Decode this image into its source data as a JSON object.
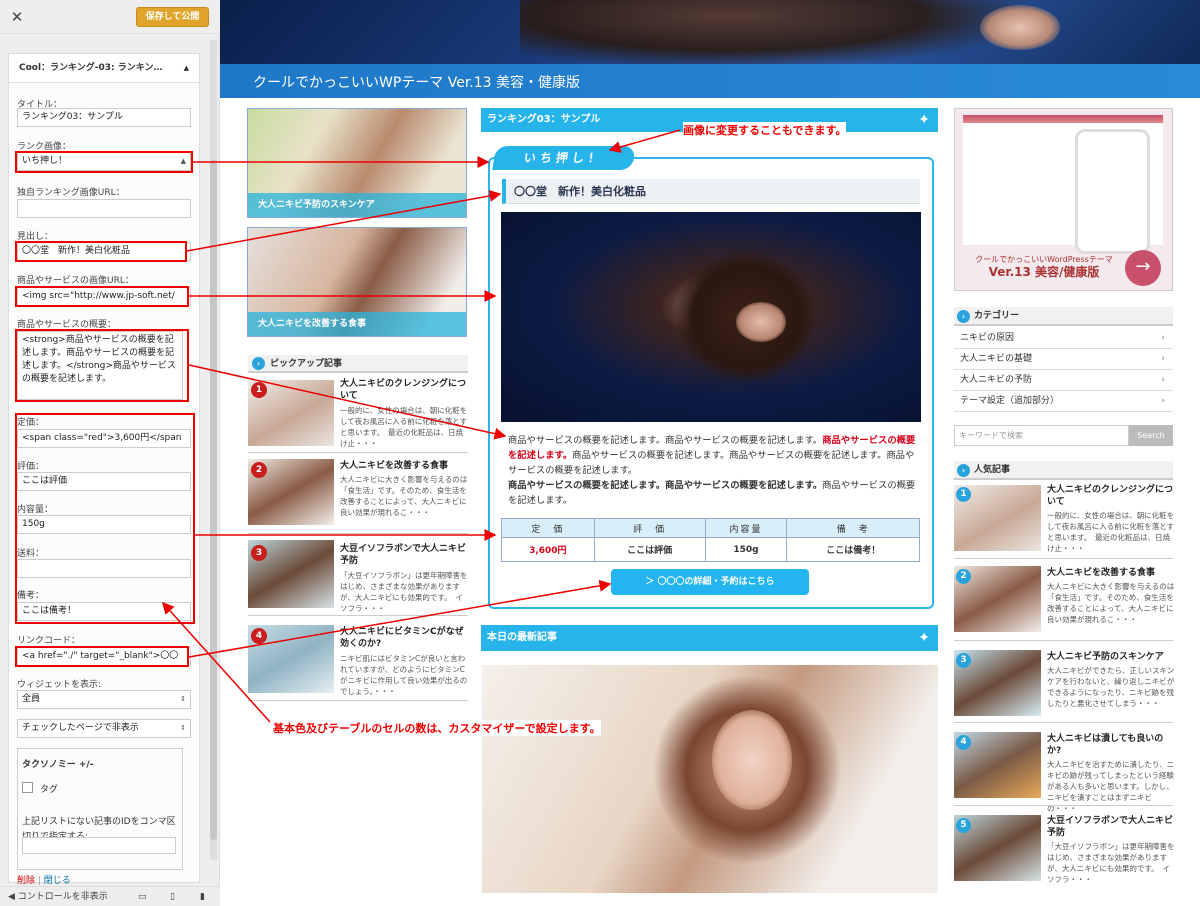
{
  "panel": {
    "close_label": "✕",
    "publish_label": "保存して公開",
    "widget_header": "Cool：ランキング-03: ランキン…",
    "fields": {
      "title_label": "タイトル：",
      "title_value": "ランキング03：サンプル",
      "rank_image_label": "ランク画像：",
      "rank_image_value": "いち押し！",
      "custom_rank_url_label": "独自ランキング画像URL：",
      "custom_rank_url_value": "",
      "heading_label": "見出し：",
      "heading_value": "〇〇堂　新作！美白化粧品",
      "image_url_label": "商品やサービスの画像URL：",
      "image_url_value": "<img src=\"http://www.jp-soft.net/",
      "summary_label": "商品やサービスの概要：",
      "summary_value": "<strong>商品やサービスの概要を記述します。商品やサービスの概要を記述します。</strong>商品やサービスの概要を記述します。",
      "price_label": "定価：",
      "price_value": "<span class=\"red\">3,600円</span",
      "rating_label": "評価：",
      "rating_value": "ここは評価",
      "volume_label": "内容量：",
      "volume_value": "150g",
      "shipping_label": "送料：",
      "shipping_value": "",
      "note_label": "備考：",
      "note_value": "ここは備考！",
      "link_label": "リンクコード：",
      "link_value": "<a href=\"./\" target=\"_blank\">〇〇",
      "show_widget_label": "ウィジェットを表示:",
      "show_widget_value": "全員",
      "hide_pages_value": "チェックしたページで非表示",
      "taxonomy_label": "タクソノミー +/-",
      "tag_label": "タグ",
      "id_note": "上記リストにない記事のIDをコンマ区切りで指定する:",
      "delete_label": "削除",
      "close_link_label": "閉じる",
      "footer_label": "コントロールを非表示"
    }
  },
  "site": {
    "title": "クールでかっこいいWPテーマ Ver.13 美容・健康版"
  },
  "left_column": {
    "feature1_caption": "大人ニキビ予防のスキンケア",
    "feature2_caption": "大人ニキビを改善する食事",
    "pickup_title": "ピックアップ記事",
    "pickup_items": [
      {
        "num": "1",
        "title": "大人ニキビのクレンジングについて",
        "excerpt": "一般的に、女性の場合は、朝に化粧をして夜お風呂に入る前に化粧を落とすと思います。　最近の化粧品は、日焼け止・・・"
      },
      {
        "num": "2",
        "title": "大人ニキビを改善する食事",
        "excerpt": "大人ニキビに大きく影響を与えるのは「食生活」です。そのため、食生活を改善することによって、大人ニキビに良い効果が現れるこ・・・"
      },
      {
        "num": "3",
        "title": "大豆イソフラボンで大人ニキビ予防",
        "excerpt": "「大豆イソフラボン」は更年期障害をはじめ、さまざまな効果がありますが、大人ニキビにも効果的です。　イソフラ・・・"
      },
      {
        "num": "4",
        "title": "大人ニキビにビタミンCがなぜ効くのか?",
        "excerpt": "ニキビ肌にはビタミンCが良いと言われていますが、どのようにビタミンCがニキビに作用して良い効果が出るのでしょう。・・・"
      }
    ]
  },
  "ranking": {
    "header": "ランキング03：サンプル",
    "badge": "いち押し！",
    "heading": "〇〇堂　新作！美白化粧品",
    "desc_1": "商品やサービスの概要を記述します。商品やサービスの概要を記述します。",
    "desc_red": "商品やサービスの概要を記述します。",
    "desc_2": "商品やサービスの概要を記述します。商品やサービスの概要を記述します。商品やサービスの概要を記述します。",
    "desc_bold": "商品やサービスの概要を記述します。商品やサービスの概要を記述します。",
    "desc_3": "商品やサービスの概要を記述します。",
    "table_headers": [
      "定　価",
      "評　価",
      "内容量",
      "備　考"
    ],
    "table_values": [
      "3,600円",
      "ここは評価",
      "150g",
      "ここは備考！"
    ],
    "detail_button": "＞ 〇〇〇の詳細・予約はこちら",
    "latest_header": "本日の最新記事"
  },
  "sidebar": {
    "ad_line1": "クールでかっこいいWordPressテーマ",
    "ad_line2": "Ver.13 美容/健康版",
    "category_title": "カテゴリー",
    "categories": [
      "ニキビの原因",
      "大人ニキビの基礎",
      "大人ニキビの予防",
      "テーマ設定（追加部分）"
    ],
    "search_placeholder": "キーワードで検索",
    "search_button": "Search",
    "popular_title": "人気記事",
    "popular_items": [
      {
        "num": "1",
        "title": "大人ニキビのクレンジングについて",
        "excerpt": "一般的に、女性の場合は、朝に化粧をして夜お風呂に入る前に化粧を落とすと思います。　最近の化粧品は、日焼け止・・・"
      },
      {
        "num": "2",
        "title": "大人ニキビを改善する食事",
        "excerpt": "大人ニキビに大きく影響を与えるのは「食生活」です。そのため、食生活を改善することによって、大人ニキビに良い効果が現れるこ・・・"
      },
      {
        "num": "3",
        "title": "大人ニキビ予防のスキンケア",
        "excerpt": "大人ニキビができたら、正しいスキンケアを行わないと、繰り返しニキビができるようになったり、ニキビ跡を残したりと悪化させてしまう・・・"
      },
      {
        "num": "4",
        "title": "大人ニキビは潰しても良いのか?",
        "excerpt": "大人ニキビを治すために潰したり、ニキビの跡が残ってしまったという経験がある人も多いと思います。しかし、ニキビを潰すことはまずニキビの・・・"
      },
      {
        "num": "5",
        "title": "大豆イソフラボンで大人ニキビ予防",
        "excerpt": "「大豆イソフラボン」は更年期障害をはじめ、さまざまな効果がありますが、大人ニキビにも効果的です。　イソフラ・・・"
      }
    ]
  },
  "annotations": {
    "image_change": "画像に変更することもできます。",
    "customizer_note": "基本色及びテーブルのセルの数は、カスタマイザーで設定します。"
  },
  "colors": {
    "accent": "#27b4ea",
    "annotation": "#ee0000",
    "publish": "#e0a42b"
  }
}
